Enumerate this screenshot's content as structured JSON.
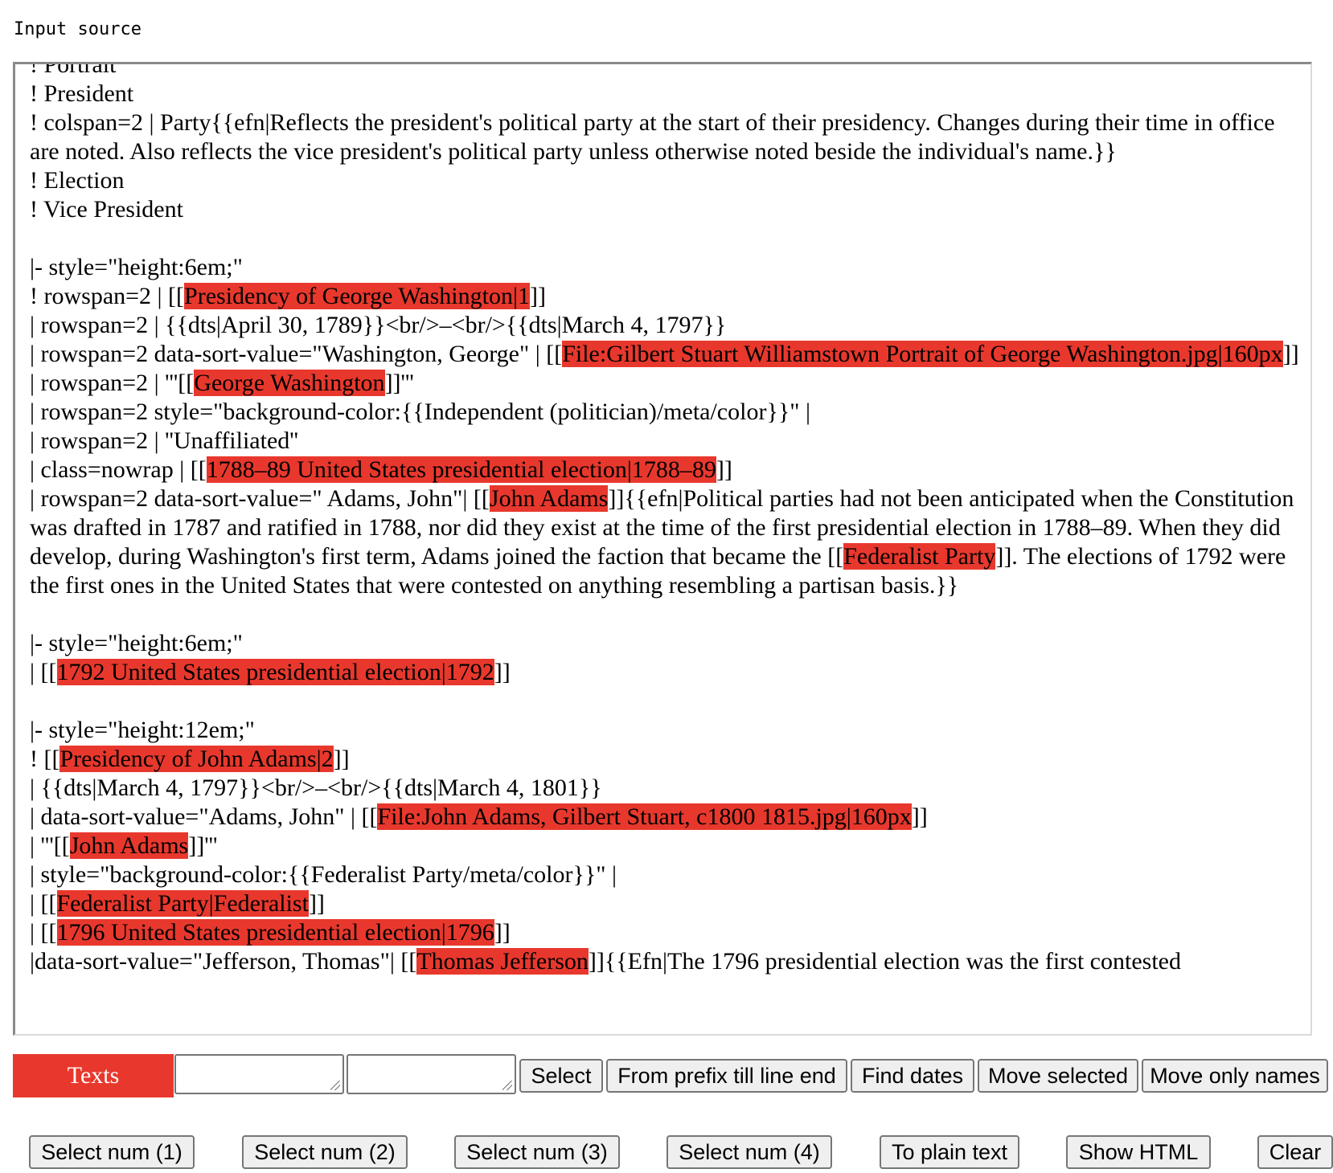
{
  "source_label": "Input source",
  "editor_lines": [
    [
      {
        "t": "! Portrait"
      }
    ],
    [
      {
        "t": "! President"
      }
    ],
    [
      {
        "t": "! colspan=2 | Party{{efn|Reflects the president's political party at the start of their presidency. Changes during their time in office are noted. Also reflects the vice president's political party unless otherwise noted beside the individual's name.}}"
      }
    ],
    [
      {
        "t": "! Election"
      }
    ],
    [
      {
        "t": "! Vice President"
      }
    ],
    [],
    [
      {
        "t": "|- style=\"height:6em;\""
      }
    ],
    [
      {
        "t": "! rowspan=2 | [["
      },
      {
        "t": "Presidency of George Washington|1",
        "h": true
      },
      {
        "t": "]]"
      }
    ],
    [
      {
        "t": "| rowspan=2 | {{dts|April 30, 1789}}<br/>–<br/>{{dts|March 4, 1797}}"
      }
    ],
    [
      {
        "t": "| rowspan=2 data-sort-value=\"Washington, George\" | [["
      },
      {
        "t": "File:Gilbert Stuart Williamstown Portrait of George Washington.jpg|160px",
        "h": true
      },
      {
        "t": "]]"
      }
    ],
    [
      {
        "t": "| rowspan=2 | '''[["
      },
      {
        "t": "George Washington",
        "h": true
      },
      {
        "t": "]]'''"
      }
    ],
    [
      {
        "t": "| rowspan=2 style=\"background-color:{{Independent (politician)/meta/color}}\" |"
      }
    ],
    [
      {
        "t": "| rowspan=2 | ''Unaffiliated''"
      }
    ],
    [
      {
        "t": "| class=nowrap | [["
      },
      {
        "t": "1788–89 United States presidential election|1788–89",
        "h": true
      },
      {
        "t": "]]"
      }
    ],
    [
      {
        "t": "| rowspan=2 data-sort-value=\" Adams, John\"| [["
      },
      {
        "t": "John Adams",
        "h": true
      },
      {
        "t": "]]{{efn|Political parties had not been anticipated when the Constitution was drafted in 1787 and ratified in 1788, nor did they exist at the time of the first presidential election in 1788–89. When they did develop, during Washington's first term, Adams joined the faction that became the [["
      },
      {
        "t": "Federalist Party",
        "h": true
      },
      {
        "t": "]]. The elections of 1792 were the first ones in the United States that were contested on anything resembling a partisan basis.}}"
      }
    ],
    [],
    [
      {
        "t": "|- style=\"height:6em;\""
      }
    ],
    [
      {
        "t": "| [["
      },
      {
        "t": "1792 United States presidential election|1792",
        "h": true
      },
      {
        "t": "]]"
      }
    ],
    [],
    [
      {
        "t": "|- style=\"height:12em;\""
      }
    ],
    [
      {
        "t": "! [["
      },
      {
        "t": "Presidency of John Adams|2",
        "h": true
      },
      {
        "t": "]]"
      }
    ],
    [
      {
        "t": "| {{dts|March 4, 1797}}<br/>–<br/>{{dts|March 4, 1801}}"
      }
    ],
    [
      {
        "t": "| data-sort-value=\"Adams, John\" | [["
      },
      {
        "t": "File:John Adams, Gilbert Stuart, c1800 1815.jpg|160px",
        "h": true
      },
      {
        "t": "]]"
      }
    ],
    [
      {
        "t": "| '''[["
      },
      {
        "t": "John Adams",
        "h": true
      },
      {
        "t": "]]'''"
      }
    ],
    [
      {
        "t": "| style=\"background-color:{{Federalist Party/meta/color}}\" |"
      }
    ],
    [
      {
        "t": "| [["
      },
      {
        "t": "Federalist Party|Federalist",
        "h": true
      },
      {
        "t": "]]"
      }
    ],
    [
      {
        "t": "| [["
      },
      {
        "t": "1796 United States presidential election|1796",
        "h": true
      },
      {
        "t": "]]"
      }
    ],
    [
      {
        "t": "|data-sort-value=\"Jefferson, Thomas\"| [["
      },
      {
        "t": "Thomas Jefferson",
        "h": true
      },
      {
        "t": "]]{{Efn|The 1796 presidential election was the first contested"
      }
    ]
  ],
  "texts_label": "Texts",
  "buttons_row1": {
    "select": "Select",
    "from_prefix": "From prefix till line end",
    "find_dates": "Find dates",
    "move_selected": "Move selected",
    "move_only_names": "Move only names"
  },
  "buttons_row2": {
    "select_num_1": "Select num (1)",
    "select_num_2": "Select num (2)",
    "select_num_3": "Select num (3)",
    "select_num_4": "Select num (4)",
    "to_plain_text": "To plain text",
    "show_html": "Show HTML",
    "clear": "Clear"
  },
  "colors": {
    "highlight": "#e8382d",
    "texts_label_bg": "#e8382d"
  }
}
